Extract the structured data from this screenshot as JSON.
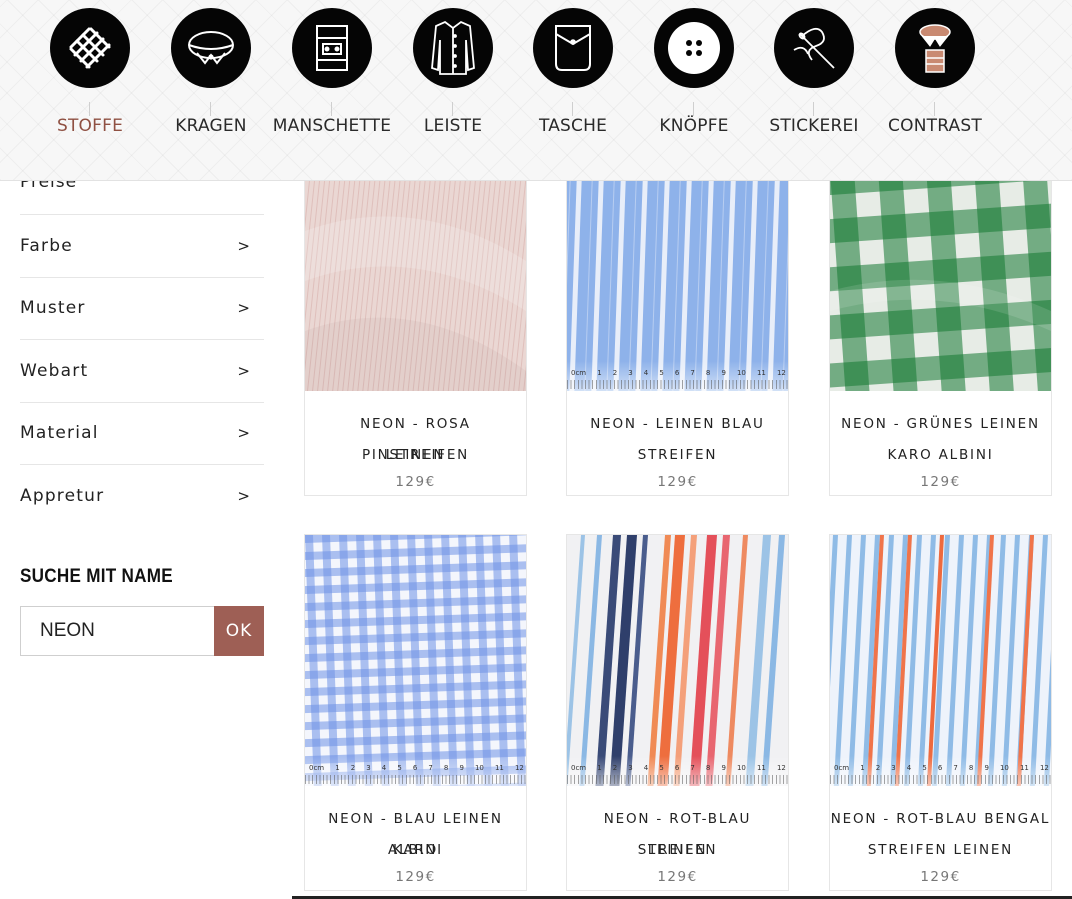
{
  "nav": {
    "items": [
      {
        "label": "STOFFE",
        "icon": "fabric-weave-icon",
        "active": true
      },
      {
        "label": "KRAGEN",
        "icon": "collar-icon",
        "active": false
      },
      {
        "label": "MANSCHETTE",
        "icon": "cuff-icon",
        "active": false
      },
      {
        "label": "LEISTE",
        "icon": "shirt-placket-icon",
        "active": false
      },
      {
        "label": "TASCHE",
        "icon": "pocket-icon",
        "active": false
      },
      {
        "label": "KNÖPFE",
        "icon": "button-icon",
        "active": false
      },
      {
        "label": "STICKEREI",
        "icon": "embroidery-needle-icon",
        "active": false
      },
      {
        "label": "CONTRAST",
        "icon": "contrast-collar-icon",
        "active": false
      }
    ]
  },
  "sidebar": {
    "peek_label": "Preise",
    "filters": [
      {
        "label": "Farbe",
        "arrow": ">"
      },
      {
        "label": "Muster",
        "arrow": ">"
      },
      {
        "label": "Webart",
        "arrow": ">"
      },
      {
        "label": "Material",
        "arrow": ">"
      },
      {
        "label": "Appretur",
        "arrow": ">"
      }
    ],
    "search_title": "SUCHE MIT NAME",
    "search_value": "NEON",
    "search_button": "OK"
  },
  "products": [
    {
      "name_line1": "NEON - ROSA PINSTREIFEN",
      "name_line2": "LEINEN",
      "price": "129€",
      "pattern": "pink-pinstripe"
    },
    {
      "name_line1": "NEON - LEINEN BLAU",
      "name_line2": "STREIFEN",
      "price": "129€",
      "pattern": "blue-stripe"
    },
    {
      "name_line1": "NEON - GRÜNES LEINEN",
      "name_line2": "KARO ALBINI",
      "price": "129€",
      "pattern": "green-check"
    },
    {
      "name_line1": "NEON - BLAU LEINEN KARO",
      "name_line2": "ALBINI",
      "price": "129€",
      "pattern": "blue-check"
    },
    {
      "name_line1": "NEON - ROT-BLAU STREIFEN",
      "name_line2": "LEINEN",
      "price": "129€",
      "pattern": "red-blue-stripe"
    },
    {
      "name_line1": "NEON - ROT-BLAU BENGAL",
      "name_line2": "STREIFEN LEINEN",
      "price": "129€",
      "pattern": "red-blue-bengal"
    }
  ],
  "ruler": {
    "unit": "0cm",
    "numbers": [
      "1",
      "2",
      "3",
      "4",
      "5",
      "6",
      "7",
      "8",
      "9",
      "10",
      "11",
      "12"
    ]
  },
  "colors": {
    "accent": "#8f5042",
    "button": "#9e5f55",
    "price": "#777777"
  }
}
